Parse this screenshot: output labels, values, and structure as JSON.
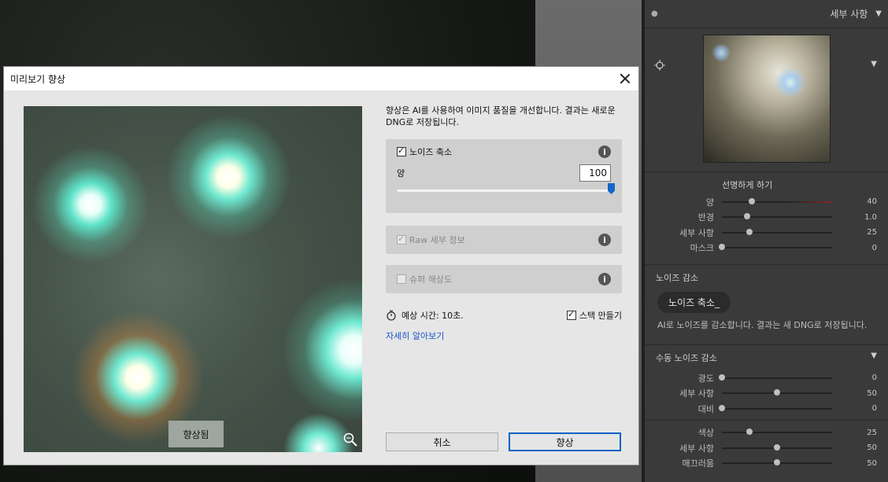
{
  "dialog": {
    "title": "미리보기 향상",
    "description": "향상은 AI를 사용하여 이미지 품질을 개선합니다. 결과는 새로운 DNG로 저장됩니다.",
    "preview_badge": "향상됨",
    "noise_reduction": {
      "label": "노이즈 축소",
      "checked": true,
      "amount_label": "양",
      "amount_value": "100",
      "amount_fraction": 1.0
    },
    "raw_details": {
      "label": "Raw 세부 정보",
      "checked": true,
      "disabled": true
    },
    "super_resolution": {
      "label": "슈퍼 해상도",
      "checked": false,
      "disabled": true
    },
    "estimate": "예상 시간: 10초.",
    "create_stack": {
      "label": "스택 만들기",
      "checked": true
    },
    "learn_more": "자세히 알아보기",
    "cancel_label": "취소",
    "enhance_label": "향상"
  },
  "panel": {
    "title": "세부 사항",
    "sharpening": {
      "title": "선명하게 하기",
      "sliders": [
        {
          "label": "양",
          "value": "40",
          "fraction": 0.27
        },
        {
          "label": "반경",
          "value": "1.0",
          "fraction": 0.23
        },
        {
          "label": "세부 사항",
          "value": "25",
          "fraction": 0.25
        },
        {
          "label": "마스크",
          "value": "0",
          "fraction": 0.0
        }
      ]
    },
    "noise_reduction": {
      "title": "노이즈 감소",
      "button_label": "노이즈 축소_",
      "description": "AI로 노이즈를 감소합니다. 결과는 새 DNG로 저장됩니다."
    },
    "manual_nr": {
      "title": "수동 노이즈 감소",
      "luminance": [
        {
          "label": "광도",
          "value": "0",
          "fraction": 0.0
        },
        {
          "label": "세부 사항",
          "value": "50",
          "fraction": 0.5
        },
        {
          "label": "대비",
          "value": "0",
          "fraction": 0.0
        }
      ],
      "color": [
        {
          "label": "색상",
          "value": "25",
          "fraction": 0.25
        },
        {
          "label": "세부 사항",
          "value": "50",
          "fraction": 0.5
        },
        {
          "label": "매끄러움",
          "value": "50",
          "fraction": 0.5
        }
      ]
    }
  }
}
